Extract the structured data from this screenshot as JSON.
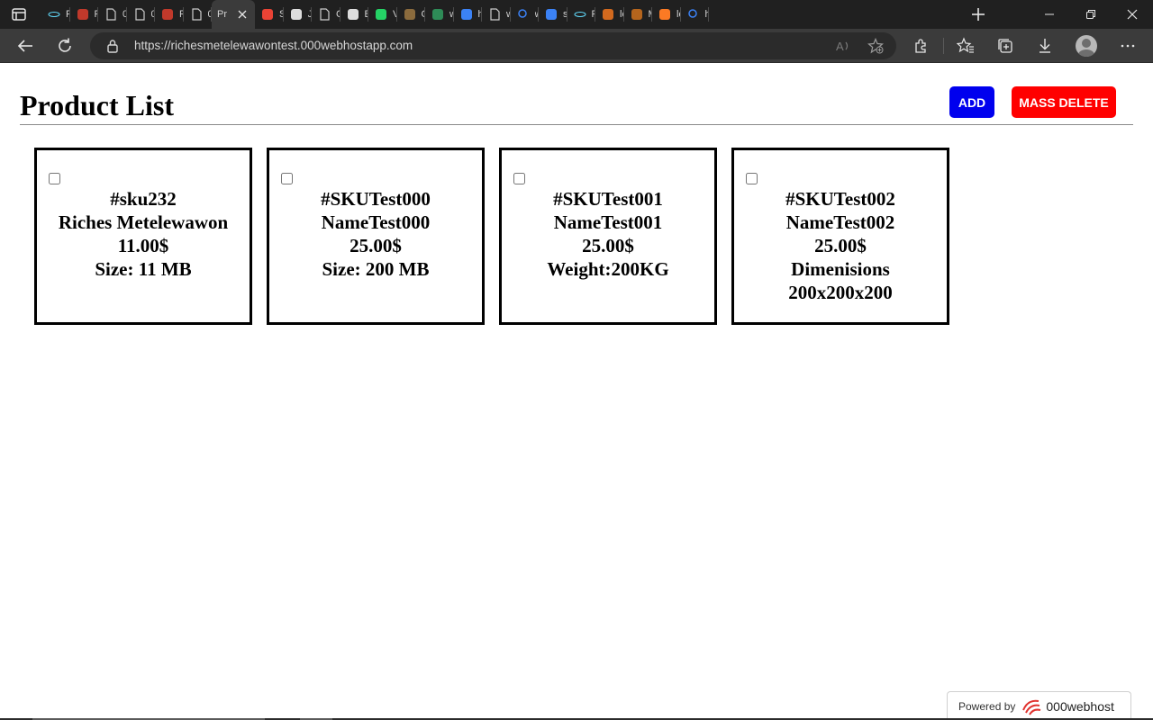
{
  "browser": {
    "tabs": [
      {
        "label": "R",
        "icon": "react-icon",
        "color": "#61dafb"
      },
      {
        "label": "Fi",
        "icon": "figma-icon",
        "color": "#c0392b"
      },
      {
        "label": "0(",
        "icon": "page-icon",
        "color": "#cccccc"
      },
      {
        "label": "0(",
        "icon": "page-icon",
        "color": "#cccccc"
      },
      {
        "label": "Fi",
        "icon": "figma-icon",
        "color": "#c0392b"
      },
      {
        "label": "0(",
        "icon": "page-icon",
        "color": "#cccccc"
      },
      {
        "label": "Pr",
        "icon": "none",
        "color": "#cccccc",
        "active": true
      },
      {
        "label": "S",
        "icon": "gmail-icon",
        "color": "#ea4335"
      },
      {
        "label": "Ju",
        "icon": "notion-icon",
        "color": "#dddddd"
      },
      {
        "label": "C",
        "icon": "page-icon",
        "color": "#cccccc"
      },
      {
        "label": "B",
        "icon": "github-icon",
        "color": "#dddddd"
      },
      {
        "label": "V",
        "icon": "whatsapp-icon",
        "color": "#25d366"
      },
      {
        "label": "C",
        "icon": "codechef-icon",
        "color": "#8b6b3d"
      },
      {
        "label": "w",
        "icon": "wellfound-icon",
        "color": "#2e8b57"
      },
      {
        "label": "h",
        "icon": "bing-icon",
        "color": "#3b82f6"
      },
      {
        "label": "w",
        "icon": "page-icon",
        "color": "#cccccc"
      },
      {
        "label": "w",
        "icon": "search-icon",
        "color": "#3b82f6"
      },
      {
        "label": "st",
        "icon": "cv-icon",
        "color": "#3b82f6"
      },
      {
        "label": "P",
        "icon": "react-icon",
        "color": "#61dafb"
      },
      {
        "label": "lc",
        "icon": "sails-icon",
        "color": "#d2691e"
      },
      {
        "label": "M",
        "icon": "bottle-icon",
        "color": "#b5651d"
      },
      {
        "label": "lc",
        "icon": "xampp-icon",
        "color": "#fb7a24"
      },
      {
        "label": "h",
        "icon": "search-icon",
        "color": "#3b82f6"
      }
    ],
    "url": "https://richesmetelewawontest.000webhostapp.com"
  },
  "page": {
    "title": "Product List",
    "add_label": "ADD",
    "mass_delete_label": "MASS DELETE",
    "products": [
      {
        "sku": "#sku232",
        "name": "Riches Metelewawon",
        "price": "11.00$",
        "attr": "Size: 11 MB",
        "attr2": ""
      },
      {
        "sku": "#SKUTest000",
        "name": "NameTest000",
        "price": "25.00$",
        "attr": "Size: 200 MB",
        "attr2": ""
      },
      {
        "sku": "#SKUTest001",
        "name": "NameTest001",
        "price": "25.00$",
        "attr": "Weight:200KG",
        "attr2": ""
      },
      {
        "sku": "#SKUTest002",
        "name": "NameTest002",
        "price": "25.00$",
        "attr": "Dimenisions",
        "attr2": "200x200x200"
      }
    ]
  },
  "footer": {
    "powered_by": "Powered by",
    "brand": "000webhost"
  }
}
